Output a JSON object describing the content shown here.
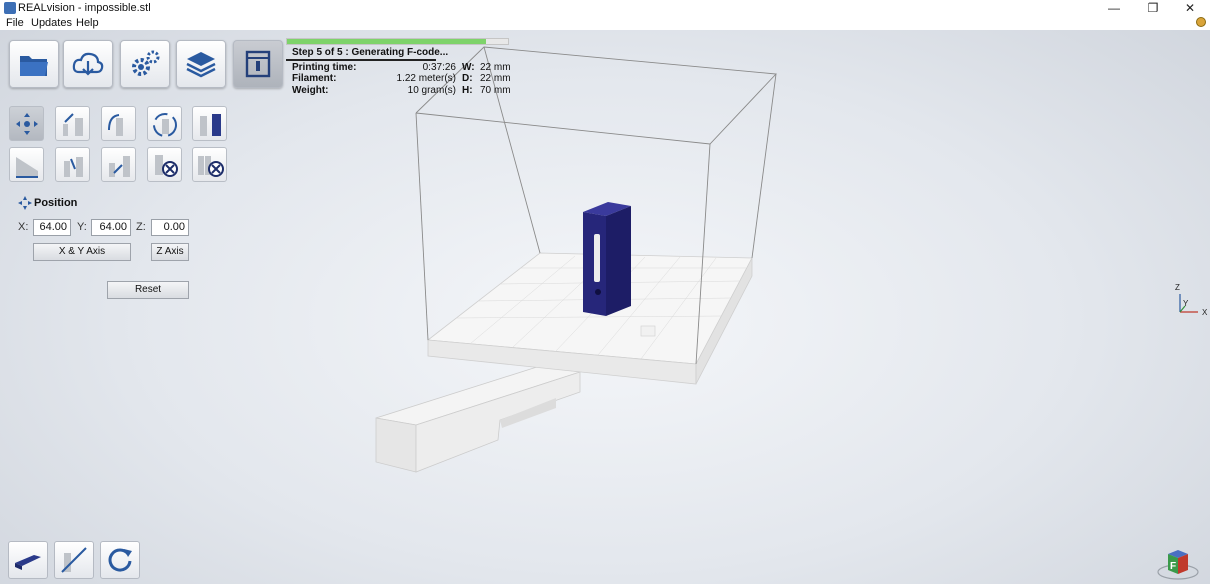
{
  "window": {
    "title": "REALvision - impossible.stl",
    "minimize": "—",
    "maximize": "❐",
    "close": "✕"
  },
  "menu": [
    "File",
    "Updates",
    "Help"
  ],
  "toolbar": {
    "main_buttons": [
      "open-folder",
      "cloud-download",
      "settings",
      "layers",
      "printer"
    ],
    "transform_buttons_row1": [
      "move",
      "scale",
      "rotate",
      "rotate-around",
      "mirror"
    ],
    "transform_buttons_row2": [
      "lay-flat",
      "drop",
      "auto-arrange",
      "delete",
      "delete-all"
    ]
  },
  "progress": {
    "fraction": 0.9,
    "step_text": "Step 5 of 5 : Generating F-code..."
  },
  "stats": {
    "printing_time_label": "Printing time:",
    "printing_time": "0:37:26",
    "filament_label": "Filament:",
    "filament": "1.22 meter(s)",
    "weight_label": "Weight:",
    "weight": "10 gram(s)",
    "w_label": "W:",
    "w": "22 mm",
    "d_label": "D:",
    "d": "22 mm",
    "h_label": "H:",
    "h": "70 mm"
  },
  "position": {
    "title": "Position",
    "x_label": "X:",
    "x": "64.00",
    "y_label": "Y:",
    "y": "64.00",
    "z_label": "Z:",
    "z": "0.00",
    "xy_button": "X & Y Axis",
    "z_button": "Z Axis",
    "reset_button": "Reset"
  },
  "axis_gizmo": {
    "z": "Z",
    "y": "Y",
    "x": "X"
  },
  "nav_cube": {
    "label": "F"
  },
  "colors": {
    "model": "#26267a",
    "progress": "#7ed36a",
    "accent": "#3d6fb5"
  }
}
